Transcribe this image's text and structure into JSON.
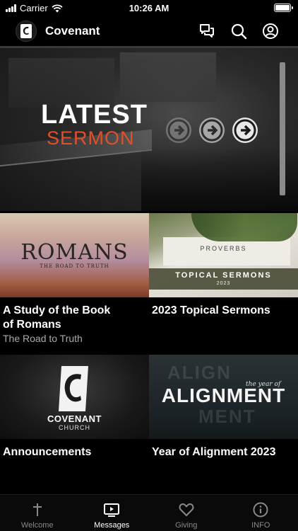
{
  "status_bar": {
    "carrier": "Carrier",
    "time": "10:26 AM"
  },
  "header": {
    "title": "Covenant",
    "icons": [
      "chat-icon",
      "search-icon",
      "account-icon"
    ]
  },
  "hero": {
    "title_line1": "LATEST",
    "title_line2": "SERMON",
    "accent_color": "#e0502a"
  },
  "series": [
    {
      "thumb": {
        "title": "ROMANS",
        "subtitle": "THE ROAD TO TRUTH"
      },
      "title_line1": "A Study of the Book",
      "title_line2": "of Romans",
      "subtitle": "The Road to Truth"
    },
    {
      "thumb": {
        "heading": "PROVERBS",
        "title": "TOPICAL SERMONS",
        "year": "2023"
      },
      "title": "2023 Topical Sermons"
    },
    {
      "thumb": {
        "name": "COVENANT",
        "church": "CHURCH"
      },
      "title": "Announcements"
    },
    {
      "thumb": {
        "small": "the year of",
        "title": "ALIGNMENT",
        "ghost_top": "ALIGN",
        "ghost_bottom": "MENT"
      },
      "title": "Year of Alignment 2023"
    }
  ],
  "tabs": [
    {
      "label": "Welcome",
      "icon": "cross-icon",
      "active": false
    },
    {
      "label": "Messages",
      "icon": "play-screen-icon",
      "active": true
    },
    {
      "label": "Giving",
      "icon": "heart-icon",
      "active": false
    },
    {
      "label": "INFO",
      "icon": "info-icon",
      "active": false
    }
  ],
  "colors": {
    "background": "#000000",
    "tab_active": "#ffffff",
    "tab_inactive": "#8a8a8a"
  }
}
